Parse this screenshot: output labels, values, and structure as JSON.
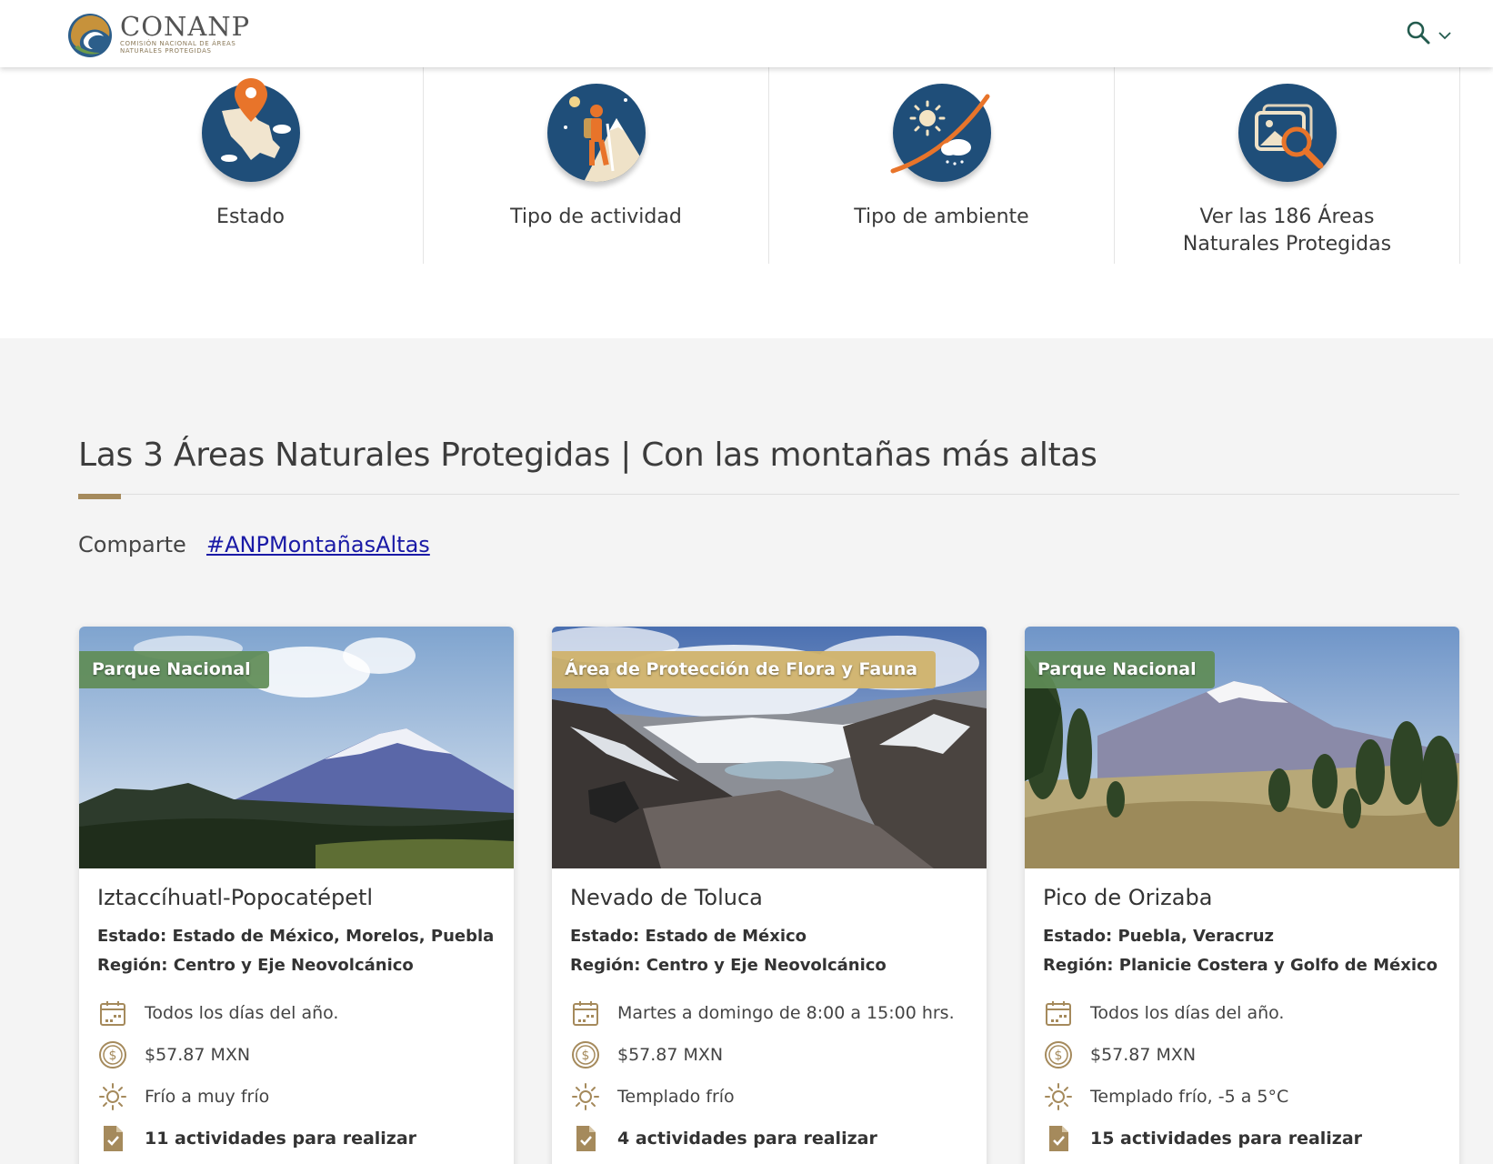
{
  "header": {
    "logo_title": "CONANP",
    "logo_subtitle": "COMISIÓN NACIONAL DE ÁREAS NATURALES PROTEGIDAS"
  },
  "filters": [
    {
      "label": "Estado",
      "icon": "map-pin-icon"
    },
    {
      "label": "Tipo de actividad",
      "icon": "hiker-icon"
    },
    {
      "label": "Tipo de ambiente",
      "icon": "weather-icon"
    },
    {
      "label": "Ver las 186 Áreas Naturales Protegidas",
      "icon": "image-search-icon"
    }
  ],
  "section": {
    "title": "Las 3 Áreas Naturales Protegidas | Con las montañas más altas",
    "share_label": "Comparte",
    "hashtag": "#ANPMontañasAltas"
  },
  "cards": [
    {
      "badge": "Parque Nacional",
      "name": "Iztaccíhuatl-Popocatépetl",
      "estado": "Estado: Estado de México, Morelos, Puebla",
      "region": "Región: Centro y Eje Neovolcánico",
      "schedule": "Todos los días del año.",
      "price": "$57.87 MXN",
      "climate": "Frío a muy frío",
      "activities": "11 actividades para realizar"
    },
    {
      "badge": "Área de Protección de Flora y Fauna",
      "name": "Nevado de Toluca",
      "estado": "Estado: Estado de México",
      "region": "Región: Centro y Eje Neovolcánico",
      "schedule": "Martes a domingo de 8:00 a 15:00 hrs.",
      "price": "$57.87 MXN",
      "climate": "Templado frío",
      "activities": "4 actividades para realizar"
    },
    {
      "badge": "Parque Nacional",
      "name": "Pico de Orizaba",
      "estado": "Estado: Puebla, Veracruz",
      "region": "Región: Planicie Costera y Golfo de México",
      "schedule": "Todos los días del año.",
      "price": "$57.87 MXN",
      "climate": "Templado frío, -5 a 5°C",
      "activities": "15 actividades para realizar"
    }
  ],
  "colors": {
    "icon_circle": "#1f4e79",
    "accent_orange": "#e8742a",
    "title_accent": "#a58a5c",
    "badge_green": "#608c56",
    "badge_gold": "#d0b268",
    "link": "#1a1aa6"
  }
}
